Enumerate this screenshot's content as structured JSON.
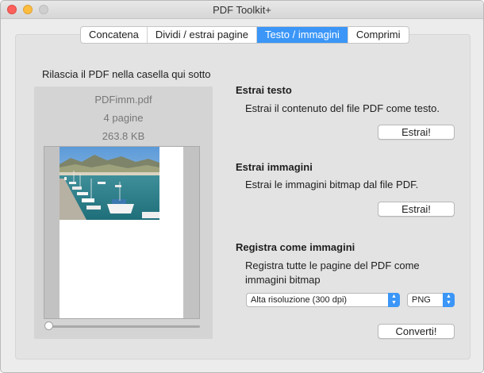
{
  "window": {
    "title": "PDF Toolkit+"
  },
  "tabs": [
    {
      "label": "Concatena",
      "active": false
    },
    {
      "label": "Dividi / estrai pagine",
      "active": false
    },
    {
      "label": "Testo / immagini",
      "active": true
    },
    {
      "label": "Comprimi",
      "active": false
    }
  ],
  "drop_area": {
    "label": "Rilascia il PDF nella casella qui sotto",
    "file_name": "PDFimm.pdf",
    "page_count": "4 pagine",
    "file_size": "263.8 KB",
    "page_slider_position": 0
  },
  "extract_text": {
    "heading": "Estrai testo",
    "description": "Estrai il contenuto del file PDF come testo.",
    "button": "Estrai!"
  },
  "extract_images": {
    "heading": "Estrai immagini",
    "description": "Estrai le immagini bitmap dal file PDF.",
    "button": "Estrai!"
  },
  "save_as_images": {
    "heading": "Registra come immagini",
    "description": "Registra tutte le pagine del PDF come immagini bitmap",
    "resolution_selected": "Alta risoluzione (300 dpi)",
    "format_selected": "PNG",
    "button": "Converti!"
  },
  "colors": {
    "accent": "#3b96f7",
    "window_bg": "#ececec"
  }
}
